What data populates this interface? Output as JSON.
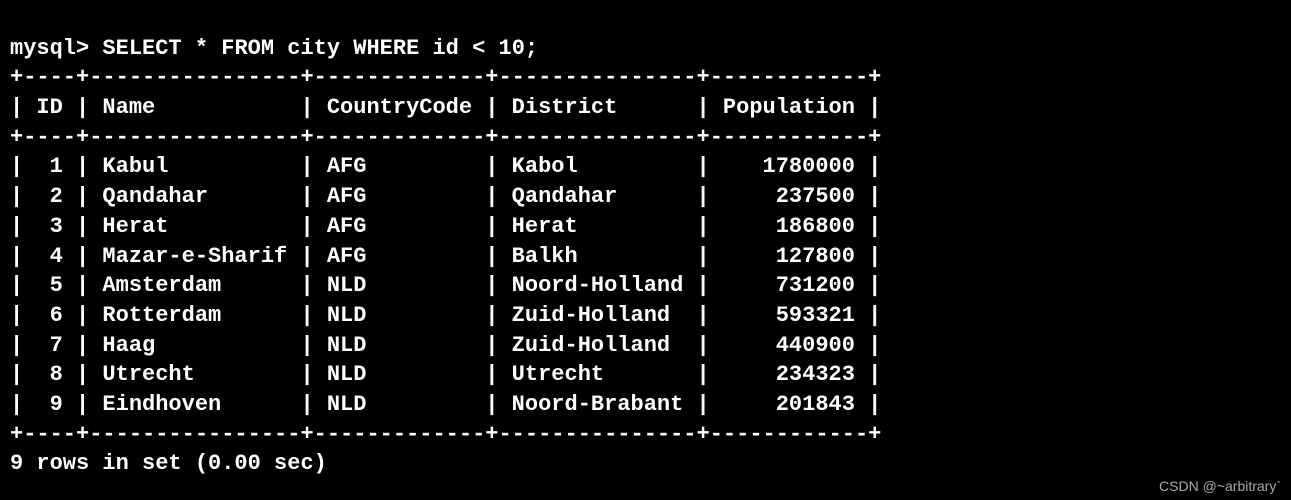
{
  "prompt": "mysql> ",
  "query": "SELECT * FROM city WHERE id < 10;",
  "table": {
    "columns": [
      "ID",
      "Name",
      "CountryCode",
      "District",
      "Population"
    ],
    "rows": [
      {
        "id": "1",
        "name": "Kabul",
        "code": "AFG",
        "district": "Kabol",
        "pop": "1780000"
      },
      {
        "id": "2",
        "name": "Qandahar",
        "code": "AFG",
        "district": "Qandahar",
        "pop": "237500"
      },
      {
        "id": "3",
        "name": "Herat",
        "code": "AFG",
        "district": "Herat",
        "pop": "186800"
      },
      {
        "id": "4",
        "name": "Mazar-e-Sharif",
        "code": "AFG",
        "district": "Balkh",
        "pop": "127800"
      },
      {
        "id": "5",
        "name": "Amsterdam",
        "code": "NLD",
        "district": "Noord-Holland",
        "pop": "731200"
      },
      {
        "id": "6",
        "name": "Rotterdam",
        "code": "NLD",
        "district": "Zuid-Holland",
        "pop": "593321"
      },
      {
        "id": "7",
        "name": "Haag",
        "code": "NLD",
        "district": "Zuid-Holland",
        "pop": "440900"
      },
      {
        "id": "8",
        "name": "Utrecht",
        "code": "NLD",
        "district": "Utrecht",
        "pop": "234323"
      },
      {
        "id": "9",
        "name": "Eindhoven",
        "code": "NLD",
        "district": "Noord-Brabant",
        "pop": "201843"
      }
    ]
  },
  "summary": "9 rows in set (0.00 sec)",
  "border": {
    "sep": "+----+----------------+-------------+---------------+------------+",
    "header": "| ID | Name           | CountryCode | District      | Population |"
  },
  "col_widths": {
    "id": 2,
    "name": 14,
    "code": 11,
    "district": 13,
    "pop": 10
  },
  "watermark": "CSDN @~arbitrary`"
}
